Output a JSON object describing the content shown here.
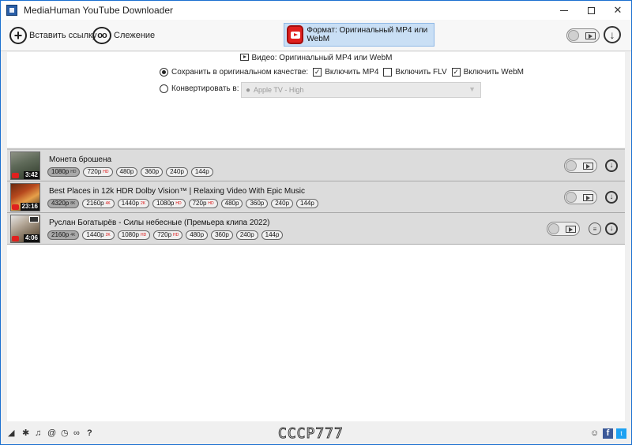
{
  "window": {
    "title": "MediaHuman YouTube Downloader",
    "minimize_glyph": "",
    "maximize_glyph": "",
    "close_glyph": "✕"
  },
  "toolbar": {
    "paste_link_label": "Вставить ссылку",
    "tracking_label": "Слежение",
    "format_label": "Формат: Оригинальный MP4 или WebM"
  },
  "settings": {
    "video_header": "Видео: Оригинальный MP4 или WebM",
    "save_original_label": "Сохранить в оригинальном качестве:",
    "include_mp4_label": "Включить MP4",
    "include_flv_label": "Включить FLV",
    "include_webm_label": "Включить WebM",
    "convert_to_label": "Конвертировать в:",
    "convert_target": "Apple TV - High",
    "save_original_selected": true,
    "include_mp4": true,
    "include_flv": false,
    "include_webm": true
  },
  "downloads": [
    {
      "title": "Монета брошена",
      "duration": "3:42",
      "qualities": [
        {
          "label": "1080р",
          "badge": "HD",
          "selected": true
        },
        {
          "label": "720р",
          "badge": "HD",
          "selected": false
        },
        {
          "label": "480р",
          "badge": "",
          "selected": false
        },
        {
          "label": "360р",
          "badge": "",
          "selected": false
        },
        {
          "label": "240р",
          "badge": "",
          "selected": false
        },
        {
          "label": "144р",
          "badge": "",
          "selected": false
        }
      ]
    },
    {
      "title": "Best Places in 12k HDR Dolby Vision™ | Relaxing Video With Epic Music",
      "duration": "23:16",
      "qualities": [
        {
          "label": "4320р",
          "badge": "8K",
          "selected": true
        },
        {
          "label": "2160р",
          "badge": "4K",
          "selected": false
        },
        {
          "label": "1440р",
          "badge": "2K",
          "selected": false
        },
        {
          "label": "1080р",
          "badge": "HD",
          "selected": false
        },
        {
          "label": "720р",
          "badge": "HD",
          "selected": false
        },
        {
          "label": "480р",
          "badge": "",
          "selected": false
        },
        {
          "label": "360р",
          "badge": "",
          "selected": false
        },
        {
          "label": "240р",
          "badge": "",
          "selected": false
        },
        {
          "label": "144р",
          "badge": "",
          "selected": false
        }
      ]
    },
    {
      "title": "Руслан Богатырёв - Силы небесные (Премьера клипа 2022)",
      "duration": "4:06",
      "qualities": [
        {
          "label": "2160р",
          "badge": "4K",
          "selected": true
        },
        {
          "label": "1440р",
          "badge": "2K",
          "selected": false
        },
        {
          "label": "1080р",
          "badge": "HD",
          "selected": false
        },
        {
          "label": "720р",
          "badge": "HD",
          "selected": false
        },
        {
          "label": "480р",
          "badge": "",
          "selected": false
        },
        {
          "label": "360р",
          "badge": "",
          "selected": false
        },
        {
          "label": "240р",
          "badge": "",
          "selected": false
        },
        {
          "label": "144р",
          "badge": "",
          "selected": false
        }
      ]
    }
  ],
  "statusbar": {
    "watermark": "CCCP777",
    "help_glyph": "?",
    "facebook_glyph": "f",
    "twitter_glyph": "t"
  },
  "colors": {
    "format_highlight": "#c9dff5",
    "youtube_red": "#e0201e",
    "row_background": "#dcdcdc",
    "facebook_blue": "#3b5998",
    "twitter_blue": "#1da1f2"
  }
}
